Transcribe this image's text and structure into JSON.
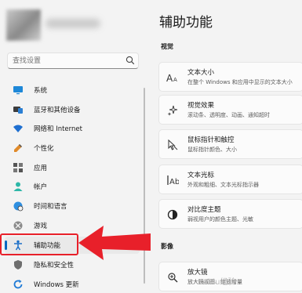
{
  "search": {
    "placeholder": "查找设置"
  },
  "sidebar": {
    "items": [
      {
        "label": "系统",
        "icon": "monitor-icon"
      },
      {
        "label": "蓝牙和其他设备",
        "icon": "bluetooth-devices-icon"
      },
      {
        "label": "网络和 Internet",
        "icon": "wifi-icon"
      },
      {
        "label": "个性化",
        "icon": "pen-icon"
      },
      {
        "label": "应用",
        "icon": "apps-icon"
      },
      {
        "label": "帐户",
        "icon": "person-icon"
      },
      {
        "label": "时间和语言",
        "icon": "globe-clock-icon"
      },
      {
        "label": "游戏",
        "icon": "xbox-icon"
      },
      {
        "label": "辅助功能",
        "icon": "accessibility-icon",
        "active": true
      },
      {
        "label": "隐私和安全性",
        "icon": "shield-icon"
      },
      {
        "label": "Windows 更新",
        "icon": "update-icon"
      }
    ]
  },
  "main": {
    "title": "辅助功能",
    "sections": [
      {
        "label": "视觉"
      },
      {
        "label": "影像"
      }
    ],
    "cards": [
      {
        "title": "文本大小",
        "subtitle": "在整个 Windows 和应用中显示的文本大小",
        "icon": "text-size-icon"
      },
      {
        "title": "视觉效果",
        "subtitle": "滚动条、透明度、动画、通知超时",
        "icon": "sparkle-icon"
      },
      {
        "title": "鼠标指针和触控",
        "subtitle": "鼠标指针颜色、大小",
        "icon": "pointer-icon"
      },
      {
        "title": "文本光标",
        "subtitle": "外观和粗细、文本光标指示器",
        "icon": "text-cursor-icon"
      },
      {
        "title": "对比度主题",
        "subtitle": "弱视用户的颜色主题、光敏",
        "icon": "contrast-icon"
      },
      {
        "title": "放大镜",
        "subtitle": "放大镜视图、缩放增量",
        "icon": "magnifier-icon"
      }
    ]
  },
  "watermark": "Baidu经验",
  "colors": {
    "accent": "#0067c0",
    "annotation": "#e8202a"
  }
}
